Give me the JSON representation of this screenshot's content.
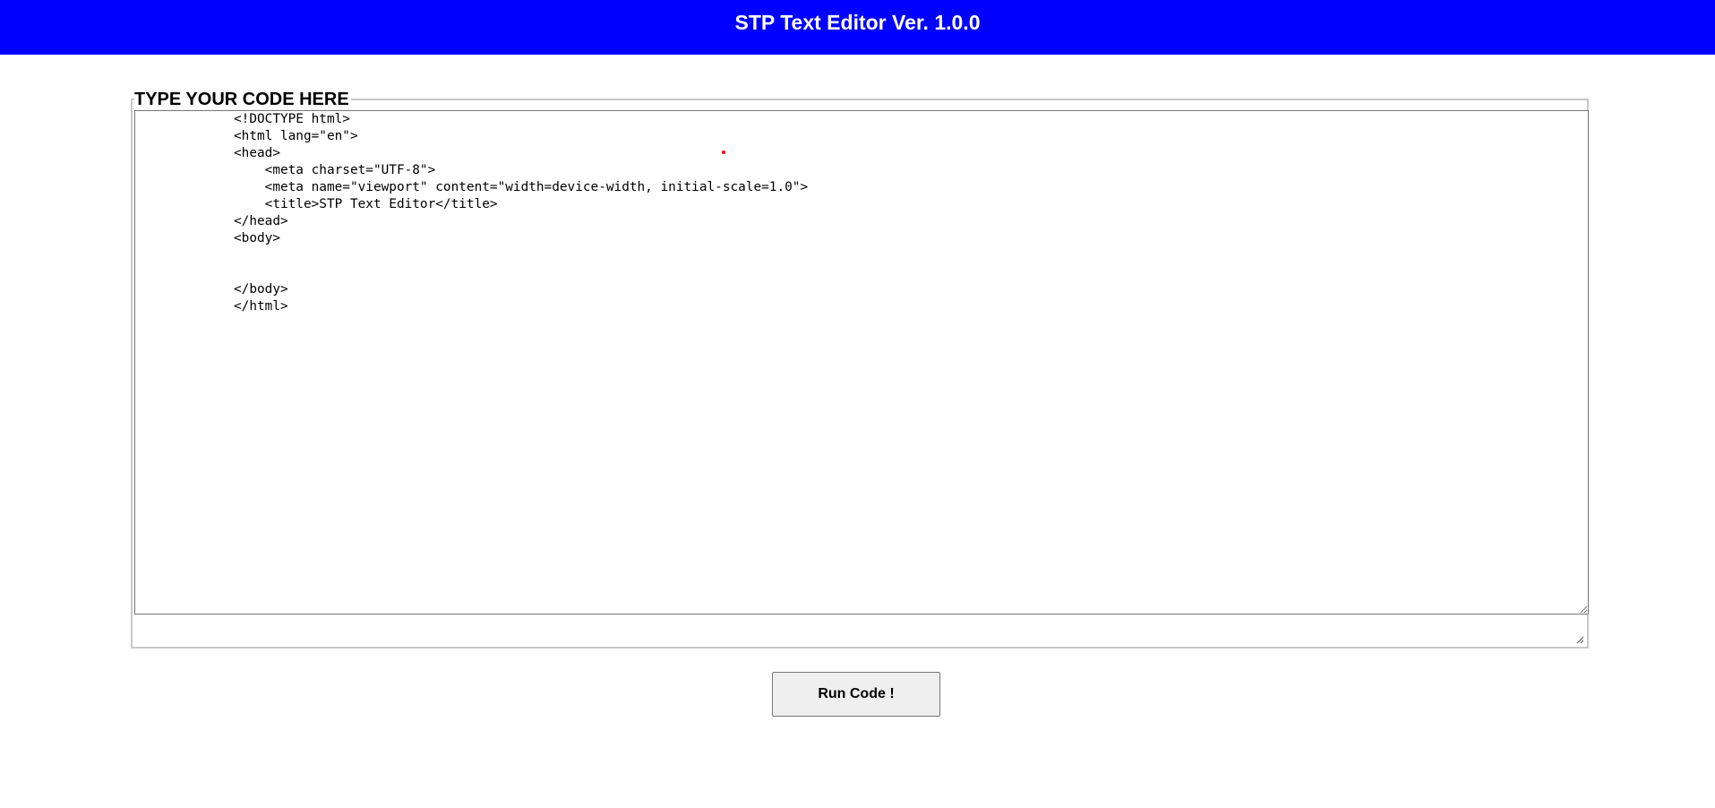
{
  "header": {
    "title": "STP Text Editor Ver. 1.0.0"
  },
  "editor": {
    "legend": "TYPE YOUR CODE HERE",
    "code": "<!DOCTYPE html>\n<html lang=\"en\">\n<head>\n    <meta charset=\"UTF-8\">\n    <meta name=\"viewport\" content=\"width=device-width, initial-scale=1.0\">\n    <title>STP Text Editor</title>\n</head>\n<body>\n\n\n</body>\n</html>"
  },
  "actions": {
    "run_label": "Run Code !"
  },
  "colors": {
    "header_bg": "#0000ff",
    "header_text": "#ffffff",
    "cursor": "#ff0000"
  },
  "icons": {
    "resize": "resize-grip-icon"
  }
}
